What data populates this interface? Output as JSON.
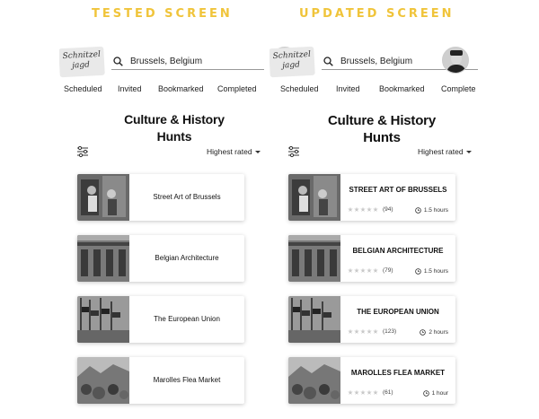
{
  "labels": {
    "tested": "TESTED SCREEN",
    "updated": "UPDATED SCREEN"
  },
  "colors": {
    "label": "#f0c43a"
  },
  "logo": {
    "line1": "Schnitzel",
    "line2": "jagd"
  },
  "search": {
    "value": "Brussels, Belgium",
    "icon": "search-icon"
  },
  "tabs": [
    "Scheduled",
    "Invited",
    "Bookmarked",
    "Completed"
  ],
  "updated_tabs_last": "Complete",
  "section": {
    "line1": "Culture & History",
    "line2": "Hunts"
  },
  "sort": "Highest rated",
  "tested_cards": [
    {
      "title": "Street Art of Brussels"
    },
    {
      "title": "Belgian Architecture"
    },
    {
      "title": "The European Union"
    },
    {
      "title": "Marolles Flea Market"
    }
  ],
  "updated_cards": [
    {
      "title": "STREET ART OF BRUSSELS",
      "count": "(94)",
      "duration": "1.5 hours"
    },
    {
      "title": "BELGIAN ARCHITECTURE",
      "count": "(79)",
      "duration": "1.5 hours"
    },
    {
      "title": "THE EUROPEAN UNION",
      "count": "(123)",
      "duration": "2 hours"
    },
    {
      "title": "MAROLLES FLEA MARKET",
      "count": "(61)",
      "duration": "1 hour"
    }
  ]
}
